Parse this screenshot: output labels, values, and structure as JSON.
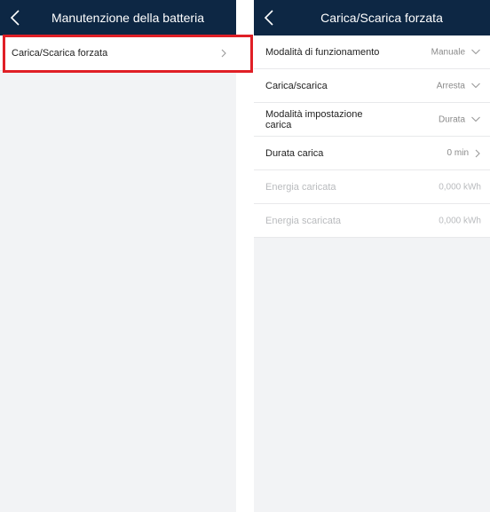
{
  "left_screen": {
    "header": {
      "title": "Manutenzione della batteria"
    },
    "items": [
      {
        "label": "Carica/Scarica forzata"
      }
    ]
  },
  "right_screen": {
    "header": {
      "title": "Carica/Scarica forzata"
    },
    "rows": [
      {
        "label": "Modalità di funzionamento",
        "value": "Manuale"
      },
      {
        "label": "Carica/scarica",
        "value": "Arresta"
      },
      {
        "label": "Modalità impostazione carica",
        "value": "Durata"
      },
      {
        "label": "Durata carica",
        "value": "0 min"
      },
      {
        "label": "Energia caricata",
        "value": "0,000 kWh"
      },
      {
        "label": "Energia scaricata",
        "value": "0,000 kWh"
      }
    ]
  },
  "colors": {
    "header_bg": "#0d2744",
    "highlight": "#e01f26",
    "page_bg": "#f2f3f5"
  },
  "icons": {
    "back": "chevron-left-icon",
    "chevron_right": "chevron-right-icon",
    "chevron_down": "chevron-down-icon"
  }
}
